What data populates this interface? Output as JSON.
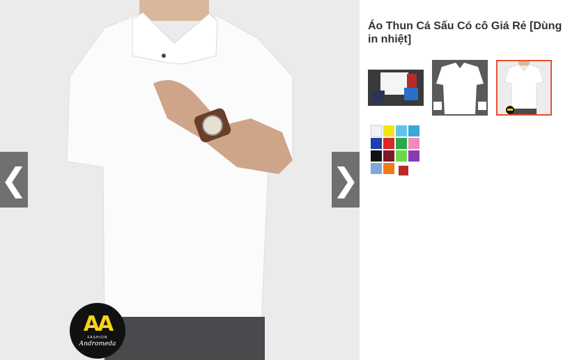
{
  "product": {
    "title": "Áo Thun Cá Sấu Có cô Giá Rẻ [Dùng in nhiệt]"
  },
  "viewer": {
    "prev_icon": "chevron-left-icon",
    "next_icon": "chevron-right-icon",
    "prev_glyph": "❮",
    "next_glyph": "❯",
    "logo": {
      "mark": "AA",
      "small": "FASHION",
      "script": "Andromeda"
    }
  },
  "thumbnails": [
    {
      "label": "thumbnail-1",
      "selected": false
    },
    {
      "label": "thumbnail-2",
      "selected": false
    },
    {
      "label": "thumbnail-3",
      "selected": true
    },
    {
      "label": "thumbnail-4",
      "selected": false
    }
  ],
  "colors": {
    "accent": "#e8502a",
    "nav_bg": "#5a5a5a"
  }
}
